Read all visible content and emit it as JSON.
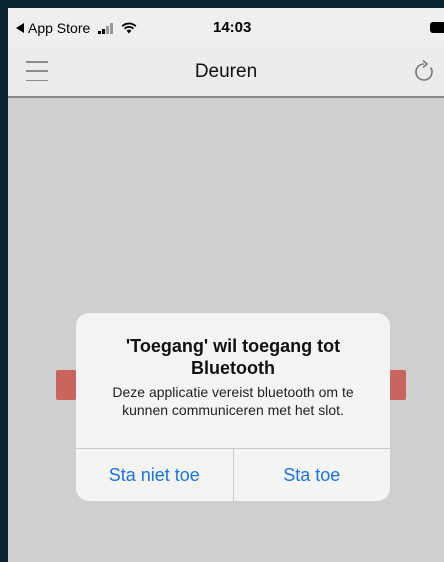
{
  "status_bar": {
    "back_app": "App Store",
    "time": "14:03"
  },
  "nav": {
    "title": "Deuren"
  },
  "alert": {
    "title": "'Toegang' wil toegang tot Bluetooth",
    "message": "Deze applicatie vereist bluetooth om te kunnen communiceren met het slot.",
    "deny_label": "Sta niet toe",
    "allow_label": "Sta toe"
  },
  "colors": {
    "accent": "#1a73e8",
    "door_strip": "#c9645f"
  },
  "icons": {
    "menu": "hamburger-menu-icon",
    "refresh": "refresh-icon",
    "wifi": "wifi-icon",
    "battery": "battery-icon"
  }
}
